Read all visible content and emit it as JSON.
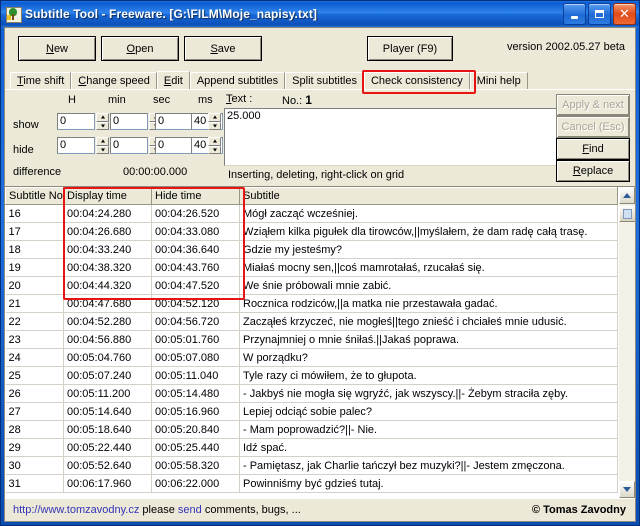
{
  "window": {
    "title": "Subtitle Tool - Freeware. [G:\\FILM\\Moje_napisy.txt]",
    "icon": "subtitle-tool-icon",
    "minimize_label": "_",
    "maximize_label": "□",
    "close_label": "✕"
  },
  "toolbar": {
    "new_label": "New",
    "open_label": "Open",
    "save_label": "Save",
    "player_label": "Player (F9)",
    "version_label": "version  2002.05.27 beta"
  },
  "tabs": [
    {
      "label": "Time shift",
      "selected": false
    },
    {
      "label": "Change speed",
      "selected": false
    },
    {
      "label": "Edit",
      "selected": true
    },
    {
      "label": "Append subtitles",
      "selected": false
    },
    {
      "label": "Split subtitles",
      "selected": false
    },
    {
      "label": "Check consistency",
      "selected": false,
      "highlighted": true
    },
    {
      "label": "Mini help",
      "selected": false
    }
  ],
  "edit_panel": {
    "col_h": "H",
    "col_min": "min",
    "col_sec": "sec",
    "col_ms": "ms",
    "row_show": "show",
    "row_hide": "hide",
    "row_difference": "difference",
    "difference_value": "00:00:00.000",
    "show": {
      "h": "0",
      "min": "0",
      "sec": "0",
      "ms": "40"
    },
    "hide": {
      "h": "0",
      "min": "0",
      "sec": "0",
      "ms": "40"
    },
    "text_label": "Text :",
    "no_label": "No.:",
    "no_value": "1",
    "text_value": "25.000",
    "hint": "Inserting, deleting, right-click on grid",
    "buttons": {
      "apply_next": "Apply & next",
      "cancel_esc": "Cancel (Esc)",
      "find": "Find",
      "replace": "Replace"
    }
  },
  "grid": {
    "headers": [
      "Subtitle No",
      "Display time",
      "Hide time",
      "Subtitle"
    ],
    "highlight_color": "#e81414",
    "rows": [
      {
        "no": "16",
        "display": "00:04:24.280",
        "hide": "00:04:26.520",
        "text": "Mógł zacząć wcześniej."
      },
      {
        "no": "17",
        "display": "00:04:26.680",
        "hide": "00:04:33.080",
        "text": "Wziąłem kilka pigułek dla tirowców,||myślałem, że dam radę całą trasę."
      },
      {
        "no": "18",
        "display": "00:04:33.240",
        "hide": "00:04:36.640",
        "text": "Gdzie my jesteśmy?"
      },
      {
        "no": "19",
        "display": "00:04:38.320",
        "hide": "00:04:43.760",
        "text": "Miałaś mocny sen,||coś mamrotałaś, rzucałaś się."
      },
      {
        "no": "20",
        "display": "00:04:44.320",
        "hide": "00:04:47.520",
        "text": "We śnie próbowali mnie zabić."
      },
      {
        "no": "21",
        "display": "00:04:47.680",
        "hide": "00:04:52.120",
        "text": "Rocznica rodziców,||a matka nie przestawała gadać."
      },
      {
        "no": "22",
        "display": "00:04:52.280",
        "hide": "00:04:56.720",
        "text": "Zacząłeś krzyczeć, nie mogłeś||tego znieść i chciałeś mnie udusić."
      },
      {
        "no": "23",
        "display": "00:04:56.880",
        "hide": "00:05:01.760",
        "text": "Przynajmniej o mnie śniłaś.||Jakaś poprawa."
      },
      {
        "no": "24",
        "display": "00:05:04.760",
        "hide": "00:05:07.080",
        "text": "W porządku?"
      },
      {
        "no": "25",
        "display": "00:05:07.240",
        "hide": "00:05:11.040",
        "text": "Tyle razy ci mówiłem, że to głupota."
      },
      {
        "no": "26",
        "display": "00:05:11.200",
        "hide": "00:05:14.480",
        "text": "- Jakbyś nie mogła się wgryźć, jak wszyscy.||- Żebym straciła zęby."
      },
      {
        "no": "27",
        "display": "00:05:14.640",
        "hide": "00:05:16.960",
        "text": "Lepiej odciąć sobie palec?"
      },
      {
        "no": "28",
        "display": "00:05:18.640",
        "hide": "00:05:20.840",
        "text": "- Mam poprowadzić?||- Nie."
      },
      {
        "no": "29",
        "display": "00:05:22.440",
        "hide": "00:05:25.440",
        "text": "Idź spać."
      },
      {
        "no": "30",
        "display": "00:05:52.640",
        "hide": "00:05:58.320",
        "text": "- Pamiętasz, jak Charlie tańczył bez muzyki?||- Jestem zmęczona."
      },
      {
        "no": "31",
        "display": "00:06:17.960",
        "hide": "00:06:22.000",
        "text": "Powinniśmy być gdzieś tutaj."
      }
    ]
  },
  "statusbar": {
    "url": "http://www.tomzavodny.cz",
    "please": "please",
    "send": "send",
    "rest": "comments, bugs, ...",
    "copyright": "© Tomas Zavodny"
  }
}
